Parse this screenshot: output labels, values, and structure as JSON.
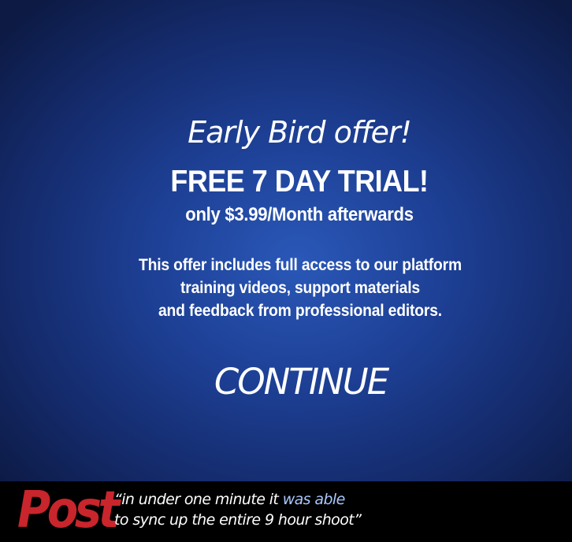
{
  "offer": {
    "intro": "Early Bird offer!",
    "title": "FREE 7 DAY TRIAL!",
    "price_line": "only $3.99/Month afterwards",
    "description_lines": [
      "This offer includes full access to our platform",
      "training videos, support materials",
      "and feedback from professional editors."
    ],
    "continue_label": "CONTINUE"
  },
  "testimonial": {
    "logo_text": "Post",
    "quote_line1_start": "“in under one minute it ",
    "quote_line1_highlight": "was able",
    "quote_line2": "to sync up the entire 9 hour shoot”"
  },
  "colors": {
    "background": "#1d3f94",
    "logo_red": "#c8252c",
    "quote_highlight": "#a9c9ff"
  }
}
